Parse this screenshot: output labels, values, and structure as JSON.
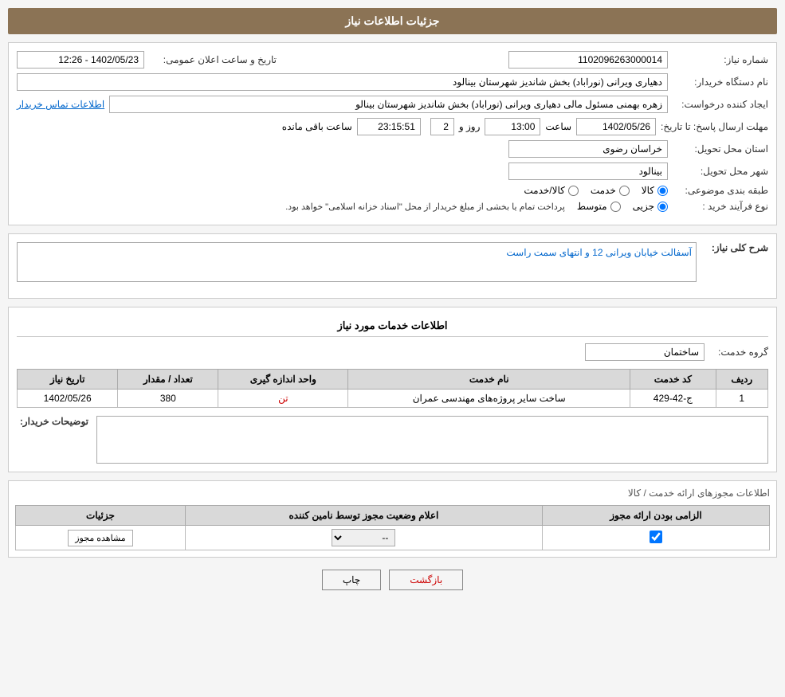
{
  "page": {
    "main_title": "جزئیات اطلاعات نیاز",
    "sections": {
      "header": {
        "need_number_label": "شماره نیاز:",
        "need_number_value": "1102096263000014",
        "date_label": "تاریخ و ساعت اعلان عمومی:",
        "date_value": "1402/05/23 - 12:26",
        "buyer_org_label": "نام دستگاه خریدار:",
        "buyer_org_value": "دهیاری ویرانی (نوراباد) بخش شاندیز شهرستان بینالود",
        "requester_label": "ایجاد کننده درخواست:",
        "requester_value": "زهره بهمنی مسئول مالی دهیاری ویرانی (نوراباد) بخش شاندیز شهرستان بینالو",
        "contact_link": "اطلاعات تماس خریدار",
        "deadline_label": "مهلت ارسال پاسخ: تا تاریخ:",
        "deadline_date": "1402/05/26",
        "deadline_time_label": "ساعت",
        "deadline_time": "13:00",
        "remaining_label": "روز و",
        "remaining_days": "2",
        "remaining_time": "23:15:51",
        "remaining_suffix": "ساعت باقی مانده",
        "province_label": "استان محل تحویل:",
        "province_value": "خراسان رضوی",
        "city_label": "شهر محل تحویل:",
        "city_value": "بینالود",
        "category_label": "طبقه بندی موضوعی:",
        "category_options": [
          "کالا",
          "خدمت",
          "کالا/خدمت"
        ],
        "category_selected": "کالا",
        "purchase_type_label": "نوع فرآیند خرید :",
        "purchase_type_options": [
          "جزیی",
          "متوسط"
        ],
        "purchase_type_selected": "جزیی",
        "purchase_type_text": "پرداخت تمام یا بخشی از مبلغ خریدار از محل \"اسناد خزانه اسلامی\" خواهد بود."
      },
      "need_description": {
        "title": "شرح کلی نیاز:",
        "value": "آسفالت خیابان ویرانی 12 و انتهای سمت راست"
      },
      "services": {
        "title": "اطلاعات خدمات مورد نیاز",
        "group_label": "گروه خدمت:",
        "group_value": "ساختمان",
        "table_headers": [
          "ردیف",
          "کد خدمت",
          "نام خدمت",
          "واحد اندازه گیری",
          "تعداد / مقدار",
          "تاریخ نیاز"
        ],
        "table_rows": [
          {
            "row": "1",
            "code": "ج-42-429",
            "name": "ساخت سایر پروژه‌های مهندسی عمران",
            "unit": "تن",
            "quantity": "380",
            "date": "1402/05/26"
          }
        ]
      },
      "buyer_notes": {
        "label": "توضیحات خریدار:",
        "value": ""
      },
      "permits": {
        "title": "اطلاعات مجوزهای ارائه خدمت / کالا",
        "table_headers": [
          "الزامی بودن ارائه مجوز",
          "اعلام وضعیت مجوز توسط نامین کننده",
          "جزئیات"
        ],
        "table_rows": [
          {
            "required": true,
            "status": "--",
            "details_btn": "مشاهده مجوز"
          }
        ]
      }
    },
    "footer": {
      "print_btn": "چاپ",
      "back_btn": "بازگشت"
    }
  }
}
